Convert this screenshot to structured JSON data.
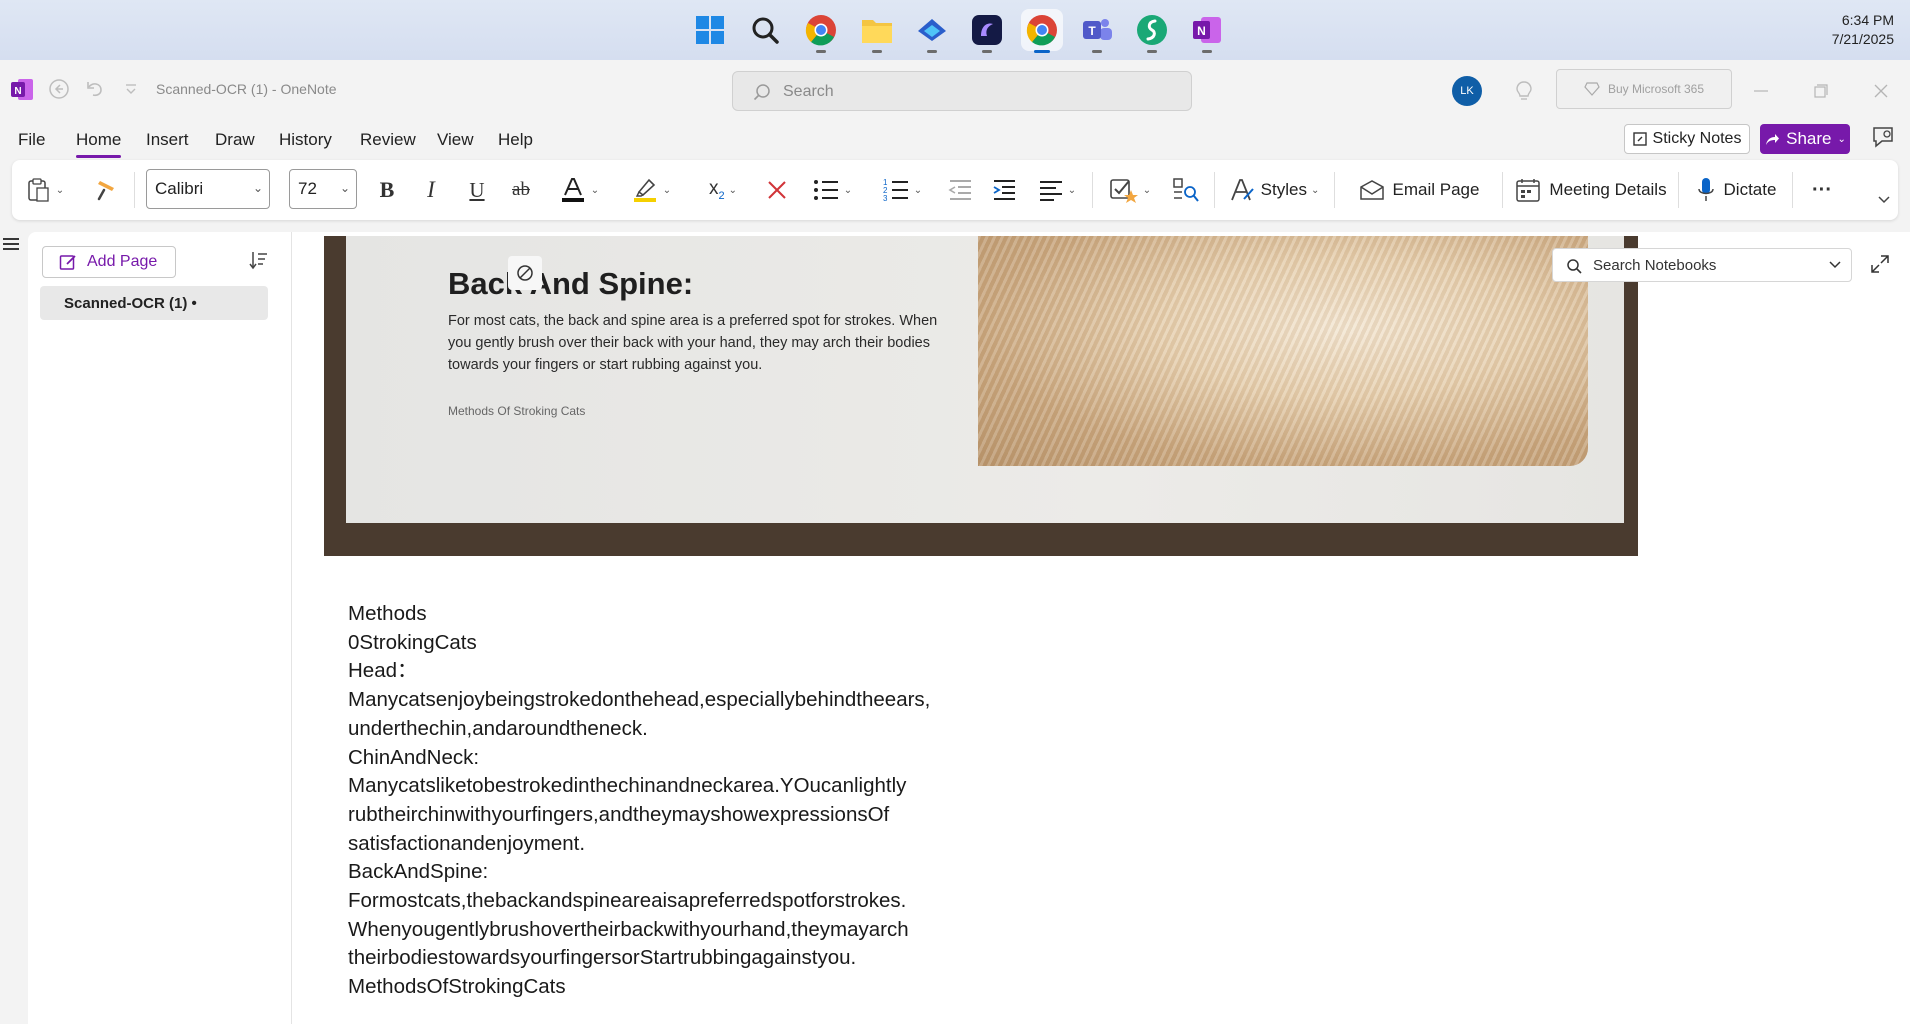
{
  "taskbar": {
    "apps": [
      "windows-start",
      "search",
      "chrome",
      "file-explorer",
      "copilot",
      "clipchamp",
      "chrome-active",
      "teams",
      "app-green",
      "onenote"
    ],
    "time": "6:34 PM",
    "date": "7/21/2025"
  },
  "titlebar": {
    "title": "Scanned-OCR (1)  -  OneNote",
    "search_placeholder": "Search",
    "avatar_initials": "LK",
    "buy_label": "Buy Microsoft 365"
  },
  "menu": {
    "tabs": [
      "File",
      "Home",
      "Insert",
      "Draw",
      "History",
      "Review",
      "View",
      "Help"
    ],
    "active": "Home",
    "sticky_notes": "Sticky Notes",
    "share": "Share"
  },
  "ribbon": {
    "font_name": "Calibri",
    "font_size": "72",
    "styles": "Styles",
    "email_page": "Email Page",
    "meeting_details": "Meeting Details",
    "dictate": "Dictate",
    "more": "···"
  },
  "pages": {
    "add_page": "Add Page",
    "current_page": "Scanned-OCR (1)  •"
  },
  "photo": {
    "title": "Back And Spine:",
    "body": "For most cats, the back and spine area is a preferred spot for strokes. When you gently brush over their back with your hand, they may arch their bodies towards your fingers or start rubbing against you.",
    "caption": "Methods Of Stroking Cats"
  },
  "ocr_lines": [
    "Methods",
    "0StrokingCats",
    "Head：",
    "Manycatsenjoybeingstrokedonthehead,especiallybehindtheears,",
    "underthechin,andaroundtheneck.",
    "ChinAndNeck:",
    "Manycatsliketobestrokedinthechinandneckarea.YOucanlightly",
    "rubtheirchinwithyourfingers,andtheymayshowexpressionsOf",
    "satisfactionandenjoyment.",
    "BackAndSpine:",
    "Formostcats,thebackandspineareaisapreferredspotforstrokes.",
    "Whenyougentlybrushovertheirbackwithyourhand,theymayarch",
    "theirbodiestowardsyourfingersorStartrubbingagainstyou.",
    "MethodsOfStrokingCats"
  ],
  "notebook_search": "Search Notebooks",
  "colors": {
    "accent": "#7719aa",
    "avatar": "#0f5ea7"
  }
}
